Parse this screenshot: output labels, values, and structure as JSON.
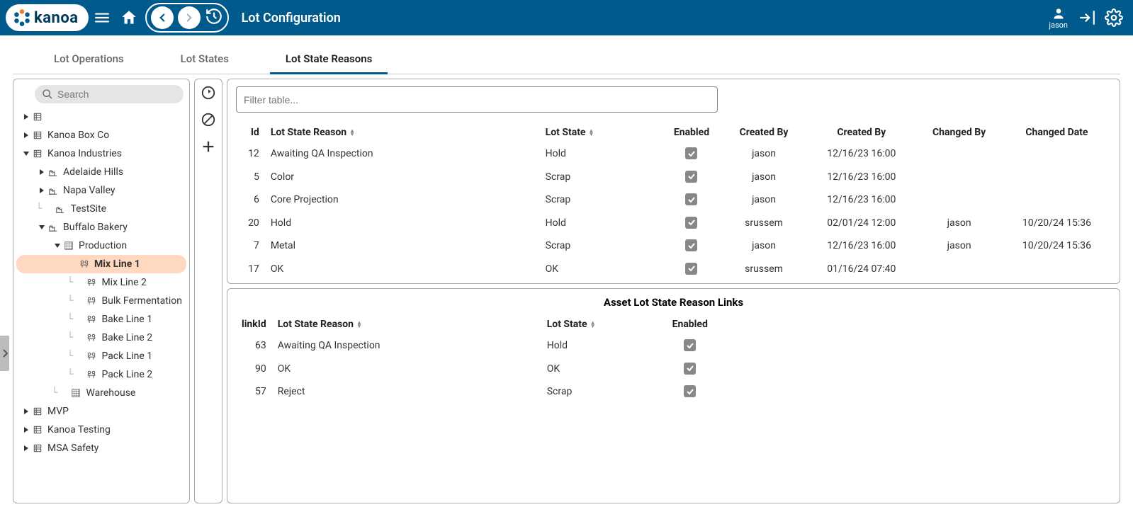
{
  "header": {
    "logo_text": "kanoa",
    "page_title": "Lot Configuration",
    "user_name": "jason"
  },
  "tabs": [
    {
      "label": "Lot Operations",
      "active": false
    },
    {
      "label": "Lot States",
      "active": false
    },
    {
      "label": "Lot State Reasons",
      "active": true
    }
  ],
  "tree": {
    "search_placeholder": "Search",
    "items": [
      {
        "level": 0,
        "caret": "closed",
        "icon": "enterprise",
        "label": "",
        "blank": true
      },
      {
        "level": 0,
        "caret": "closed",
        "icon": "enterprise",
        "label": "Kanoa Box Co"
      },
      {
        "level": 0,
        "caret": "open",
        "icon": "enterprise",
        "label": "Kanoa Industries"
      },
      {
        "level": 1,
        "caret": "closed",
        "icon": "site",
        "label": "Adelaide Hills"
      },
      {
        "level": 1,
        "caret": "closed",
        "icon": "site",
        "label": "Napa Valley"
      },
      {
        "level": 1,
        "caret": "none",
        "icon": "site",
        "label": "TestSite",
        "line": true
      },
      {
        "level": 1,
        "caret": "open",
        "icon": "site",
        "label": "Buffalo Bakery"
      },
      {
        "level": 2,
        "caret": "open",
        "icon": "area",
        "label": "Production"
      },
      {
        "level": 3,
        "caret": "none",
        "icon": "cell",
        "label": "Mix Line 1",
        "selected": true
      },
      {
        "level": 3,
        "caret": "none",
        "icon": "cell",
        "label": "Mix Line 2",
        "line": true
      },
      {
        "level": 3,
        "caret": "none",
        "icon": "cell",
        "label": "Bulk Fermentation",
        "line": true
      },
      {
        "level": 3,
        "caret": "none",
        "icon": "cell",
        "label": "Bake Line 1",
        "line": true
      },
      {
        "level": 3,
        "caret": "none",
        "icon": "cell",
        "label": "Bake Line 2",
        "line": true
      },
      {
        "level": 3,
        "caret": "none",
        "icon": "cell",
        "label": "Pack Line 1",
        "line": true
      },
      {
        "level": 3,
        "caret": "none",
        "icon": "cell",
        "label": "Pack Line 2",
        "line": true
      },
      {
        "level": 2,
        "caret": "none",
        "icon": "area",
        "label": "Warehouse",
        "line": true
      },
      {
        "level": 0,
        "caret": "closed",
        "icon": "enterprise",
        "label": "MVP"
      },
      {
        "level": 0,
        "caret": "closed",
        "icon": "enterprise",
        "label": "Kanoa Testing"
      },
      {
        "level": 0,
        "caret": "closed",
        "icon": "enterprise",
        "label": "MSA Safety"
      }
    ]
  },
  "reasons_table": {
    "filter_placeholder": "Filter table...",
    "columns": {
      "id": "Id",
      "reason": "Lot State Reason",
      "state": "Lot State",
      "enabled": "Enabled",
      "created_by": "Created By",
      "created_by2": "Created By",
      "changed_by": "Changed By",
      "changed_date": "Changed Date"
    },
    "rows": [
      {
        "id": "12",
        "reason": "Awaiting QA Inspection",
        "state": "Hold",
        "enabled": true,
        "created_by": "jason",
        "created_by2": "12/16/23 16:00",
        "changed_by": "",
        "changed_date": ""
      },
      {
        "id": "5",
        "reason": "Color",
        "state": "Scrap",
        "enabled": true,
        "created_by": "jason",
        "created_by2": "12/16/23 16:00",
        "changed_by": "",
        "changed_date": ""
      },
      {
        "id": "6",
        "reason": "Core Projection",
        "state": "Scrap",
        "enabled": true,
        "created_by": "jason",
        "created_by2": "12/16/23 16:00",
        "changed_by": "",
        "changed_date": ""
      },
      {
        "id": "20",
        "reason": "Hold",
        "state": "Hold",
        "enabled": true,
        "created_by": "srussem",
        "created_by2": "02/01/24 12:00",
        "changed_by": "jason",
        "changed_date": "10/20/24 15:36"
      },
      {
        "id": "7",
        "reason": "Metal",
        "state": "Scrap",
        "enabled": true,
        "created_by": "jason",
        "created_by2": "12/16/23 16:00",
        "changed_by": "jason",
        "changed_date": "10/20/24 15:36"
      },
      {
        "id": "17",
        "reason": "OK",
        "state": "OK",
        "enabled": true,
        "created_by": "srussem",
        "created_by2": "01/16/24 07:40",
        "changed_by": "",
        "changed_date": ""
      }
    ]
  },
  "links_table": {
    "title": "Asset Lot State Reason Links",
    "columns": {
      "linkId": "linkId",
      "reason": "Lot State Reason",
      "state": "Lot State",
      "enabled": "Enabled"
    },
    "rows": [
      {
        "linkId": "63",
        "reason": "Awaiting QA Inspection",
        "state": "Hold",
        "enabled": true
      },
      {
        "linkId": "90",
        "reason": "OK",
        "state": "OK",
        "enabled": true
      },
      {
        "linkId": "57",
        "reason": "Reject",
        "state": "Scrap",
        "enabled": true
      }
    ]
  }
}
